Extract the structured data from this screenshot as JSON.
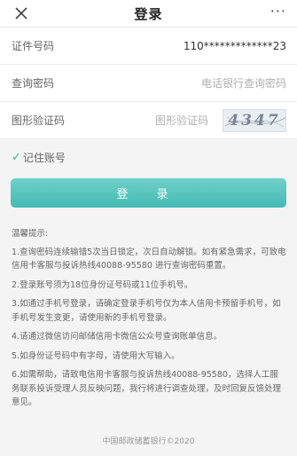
{
  "header": {
    "title": "登录",
    "more": "···"
  },
  "form": {
    "id_label": "证件号码",
    "id_value": "110*************23",
    "password_label": "查询密码",
    "password_placeholder": "电话银行查询密码",
    "captcha_label": "图形验证码",
    "captcha_placeholder": "图形验证码",
    "captcha_text": "4347",
    "remember_label": "记住账号",
    "login_button": "登 录"
  },
  "tips": {
    "title": "温馨提示:",
    "items": [
      "1.查询密码连续输错5次当日锁定，次日自动解锁。如有紧急需求，可致电信用卡客服与投诉热线40088-95580 进行查询密码重置。",
      "2.登录账号须为18位身份证号码或11位手机号。",
      "3.如通过手机号登录，请确定登录手机号仅为本人信用卡预留手机号，如手机号发生变更，请使用新的手机号登录。",
      "4.请通过微信访问邮储信用卡微信公众号查询账单信息。",
      "5.如身份证号码中有字母，请使用大写输入。",
      "6.如需帮助，请致电信用卡客服与投诉热线40088-95580，选择人工服务联系投诉受理人员反映问题，我行将进行调查处理，及时回复反馈处理意见。"
    ]
  },
  "footer": {
    "copyright": "中国邮政储蓄银行©2020"
  },
  "colors": {
    "accent": "#45bab4",
    "check": "#2fb9a5"
  },
  "icons": {
    "close": "close-icon",
    "check": "check-icon"
  }
}
